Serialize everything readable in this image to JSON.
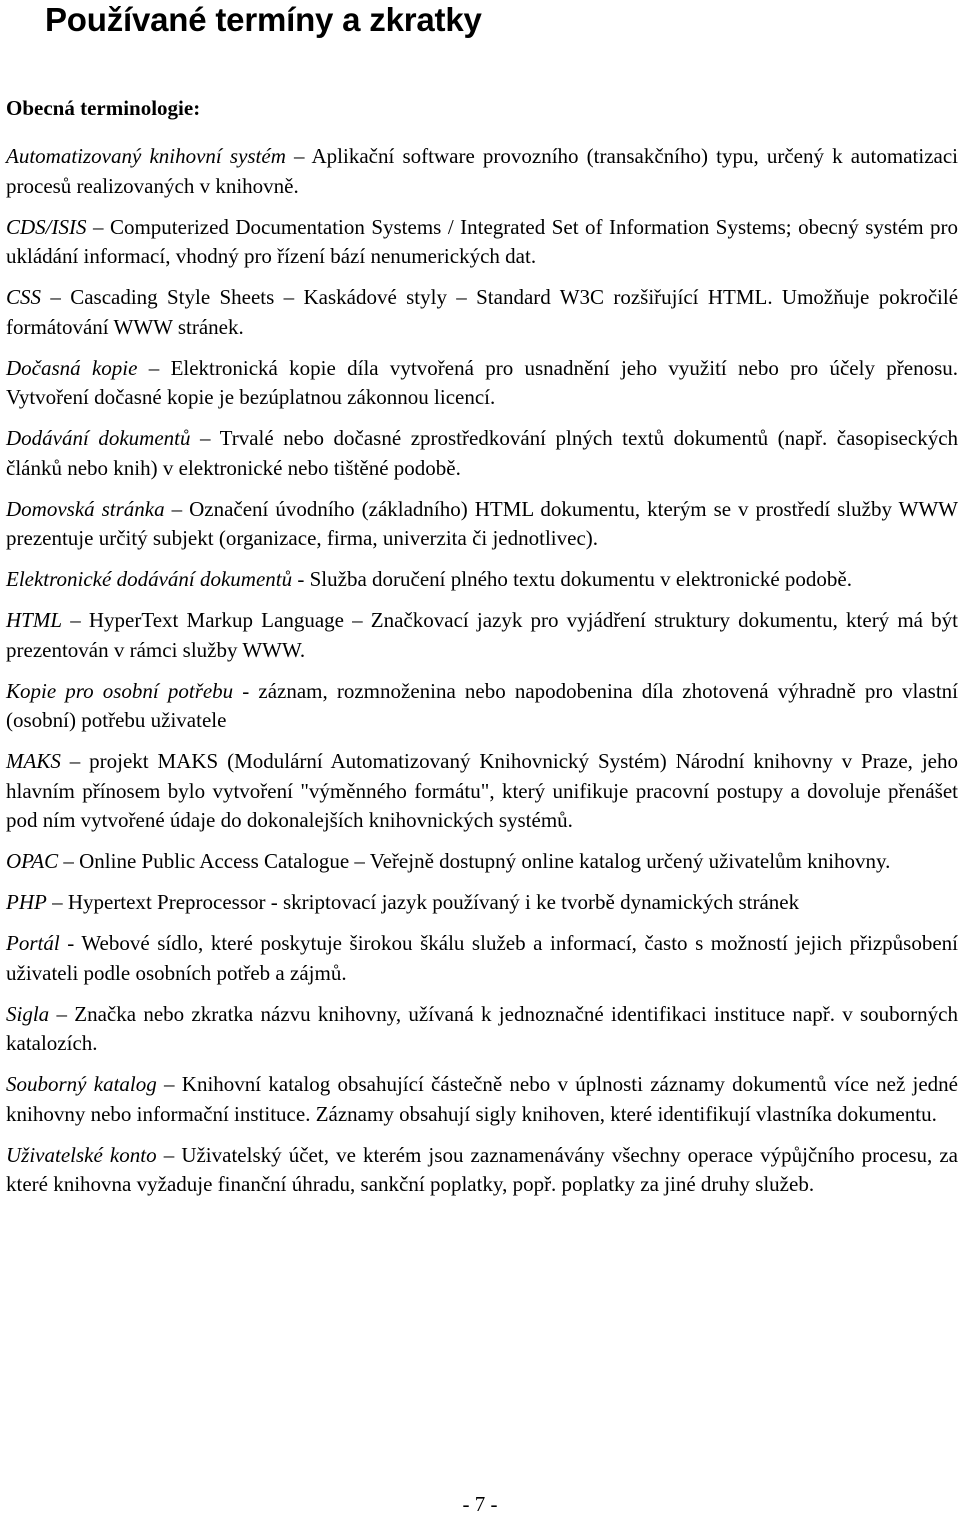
{
  "document": {
    "title": "Používané termíny a zkratky",
    "subtitle": "Obecná terminologie:",
    "entries": [
      {
        "term": "Automatizovaný knihovní systém",
        "sep": " – ",
        "definition": "Aplikační software provozního (transakčního) typu, určený k automatizaci procesů realizovaných v knihovně."
      },
      {
        "term": "CDS/ISIS",
        "sep": " – ",
        "definition": "Computerized Documentation Systems / Integrated Set of Information Systems; obecný systém pro ukládání informací, vhodný pro řízení bází nenumerických dat."
      },
      {
        "term": "CSS",
        "sep": " – ",
        "definition": "Cascading Style Sheets – Kaskádové styly – Standard W3C rozšiřující HTML. Umožňuje pokročilé formátování WWW stránek."
      },
      {
        "term": "Dočasná kopie",
        "sep": " – ",
        "definition": "Elektronická kopie díla vytvořená pro usnadnění jeho využití nebo pro účely přenosu. Vytvoření dočasné kopie je bezúplatnou zákonnou licencí."
      },
      {
        "term": "Dodávání dokumentů",
        "sep": " – ",
        "definition": "Trvalé nebo dočasné zprostředkování plných textů dokumentů (např. časopiseckých článků nebo knih) v elektronické nebo tištěné podobě."
      },
      {
        "term": "Domovská stránka",
        "sep": " – ",
        "definition": "Označení úvodního (základního) HTML dokumentu, kterým se v prostředí služby WWW prezentuje určitý subjekt (organizace, firma, univerzita či jednotlivec)."
      },
      {
        "term": "Elektronické dodávání dokumentů",
        "sep": " - ",
        "definition": "Služba doručení plného textu dokumentu v elektronické podobě."
      },
      {
        "term": "HTML",
        "sep": " – ",
        "definition": "HyperText Markup Language – Značkovací jazyk pro vyjádření struktury dokumentu, který má být prezentován v rámci služby WWW."
      },
      {
        "term": "Kopie pro osobní potřebu",
        "sep": " - ",
        "definition": "záznam, rozmnoženina nebo napodobenina díla zhotovená výhradně pro vlastní (osobní) potřebu uživatele"
      },
      {
        "term": "MAKS",
        "sep": " – ",
        "definition": "projekt MAKS (Modulární Automatizovaný Knihovnický Systém) Národní knihovny v Praze, jeho hlavním přínosem bylo vytvoření \"výměnného formátu\", který unifikuje pracovní postupy a dovoluje přenášet pod ním vytvořené údaje do dokonalejších knihovnických systémů."
      },
      {
        "term": "OPAC",
        "sep": " – ",
        "definition": "Online Public Access Catalogue – Veřejně dostupný online katalog určený uživatelům knihovny."
      },
      {
        "term": "PHP",
        "sep": " – ",
        "definition": "Hypertext Preprocessor - skriptovací jazyk používaný i ke tvorbě dynamických stránek"
      },
      {
        "term": "Portál",
        "sep": " - ",
        "definition": "Webové sídlo, které poskytuje širokou škálu služeb a informací, často s možností jejich přizpůsobení uživateli podle osobních potřeb a zájmů."
      },
      {
        "term": "Sigla",
        "sep": " – ",
        "definition": "Značka nebo zkratka názvu knihovny, užívaná k jednoznačné identifikaci instituce např. v souborných katalozích."
      },
      {
        "term": "Souborný katalog",
        "sep": " – ",
        "definition": "Knihovní katalog obsahující částečně nebo v úplnosti záznamy dokumentů více než jedné knihovny nebo informační instituce. Záznamy obsahují sigly knihoven, které identifikují vlastníka dokumentu."
      },
      {
        "term": "Uživatelské konto",
        "sep": " – ",
        "definition": "Uživatelský účet, ve kterém jsou zaznamenávány všechny operace výpůjčního procesu, za které knihovna vyžaduje finanční úhradu, sankční poplatky, popř. poplatky za jiné druhy služeb."
      }
    ],
    "page_number": "- 7 -"
  }
}
